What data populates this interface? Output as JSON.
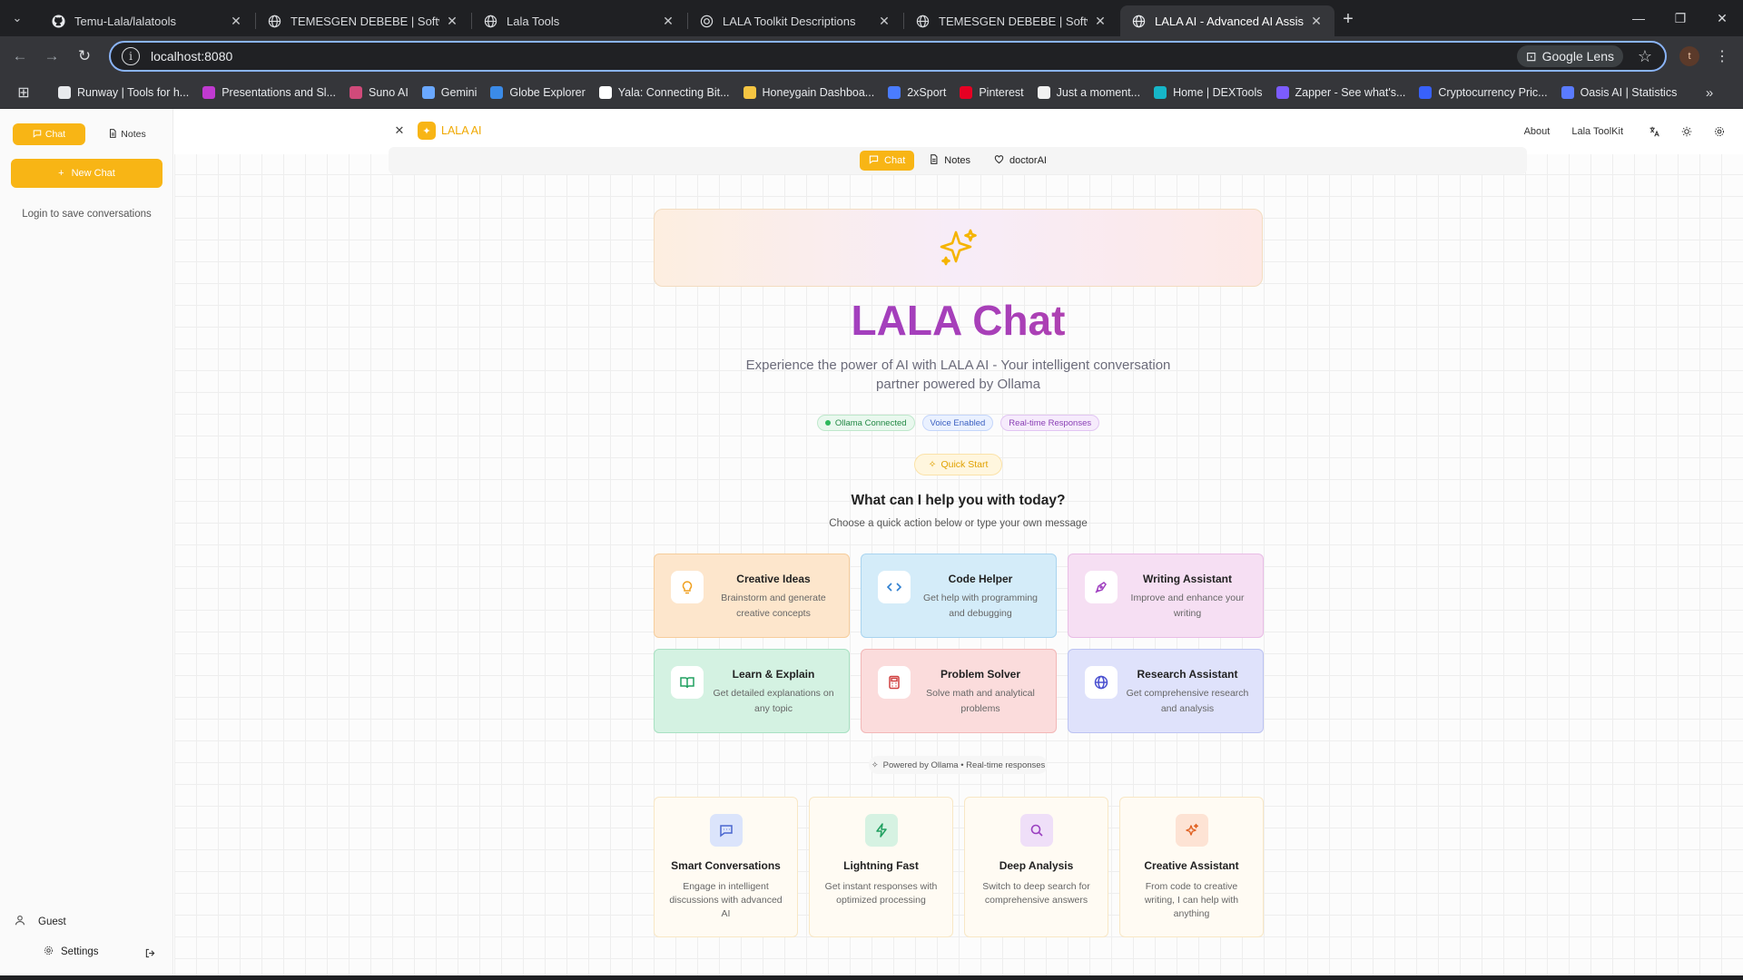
{
  "browser": {
    "tabs": [
      {
        "title": "Temu-Lala/lalatools",
        "icon": "github-icon"
      },
      {
        "title": "TEMESGEN DEBEBE | Software E",
        "icon": "globe-icon"
      },
      {
        "title": "Lala Tools",
        "icon": "globe-icon"
      },
      {
        "title": "LALA Toolkit Descriptions",
        "icon": "globe-icon"
      },
      {
        "title": "TEMESGEN DEBEBE | Software E",
        "icon": "globe-icon"
      },
      {
        "title": "LALA AI - Advanced AI Assistan",
        "icon": "globe-icon",
        "active": true
      }
    ],
    "url": "localhost:8080",
    "lens_label": "Google Lens",
    "profile_initial": "t",
    "bookmarks": [
      {
        "label": "Runway | Tools for h...",
        "color": "#e8eaed"
      },
      {
        "label": "Presentations and Sl...",
        "color": "#c03ad0"
      },
      {
        "label": "Suno AI",
        "color": "#d04a7a"
      },
      {
        "label": "Gemini",
        "color": "#6aa8ff"
      },
      {
        "label": "Globe Explorer",
        "color": "#3b8be8"
      },
      {
        "label": "Yala: Connecting Bit...",
        "color": "#ffffff"
      },
      {
        "label": "Honeygain Dashboa...",
        "color": "#f5c542"
      },
      {
        "label": "2xSport",
        "color": "#4a7cff"
      },
      {
        "label": "Pinterest",
        "color": "#e60023"
      },
      {
        "label": "Just a moment...",
        "color": "#f1f1f1"
      },
      {
        "label": "Home | DEXTools",
        "color": "#16b6c8"
      },
      {
        "label": "Zapper - See what's...",
        "color": "#7c5cff"
      },
      {
        "label": "Cryptocurrency Pric...",
        "color": "#3861fb"
      },
      {
        "label": "Oasis AI | Statistics",
        "color": "#5a7bff"
      }
    ]
  },
  "sidebar": {
    "tabs": [
      {
        "label": "Chat",
        "active": true
      },
      {
        "label": "Notes",
        "active": false
      }
    ],
    "new_chat_label": "New Chat",
    "login_note": "Login to save conversations",
    "user_label": "Guest",
    "settings_label": "Settings"
  },
  "header": {
    "brand": "LALA AI",
    "links": [
      "About",
      "Lala ToolKit"
    ],
    "modes": [
      {
        "label": "Chat",
        "active": true
      },
      {
        "label": "Notes",
        "active": false
      },
      {
        "label": "doctorAI",
        "active": false
      }
    ]
  },
  "hero": {
    "title": "LALA Chat",
    "subtitle": "Experience the power of AI with LALA AI - Your intelligent conversation partner powered by Ollama",
    "badges": [
      "Ollama Connected",
      "Voice Enabled",
      "Real-time Responses"
    ],
    "quick_start": "Quick Start",
    "help_title": "What can I help you with today?",
    "help_subtitle": "Choose a quick action below or type your own message"
  },
  "actions": [
    {
      "title": "Creative Ideas",
      "desc": "Brainstorm and generate creative concepts",
      "icon": "lightbulb-icon",
      "color": "#f0a020"
    },
    {
      "title": "Code Helper",
      "desc": "Get help with programming and debugging",
      "icon": "code-icon",
      "color": "#2f7fd0"
    },
    {
      "title": "Writing Assistant",
      "desc": "Improve and enhance your writing",
      "icon": "pen-icon",
      "color": "#a040c0"
    },
    {
      "title": "Learn & Explain",
      "desc": "Get detailed explanations on any topic",
      "icon": "book-icon",
      "color": "#20a060"
    },
    {
      "title": "Problem Solver",
      "desc": "Solve math and analytical problems",
      "icon": "calculator-icon",
      "color": "#d04040"
    },
    {
      "title": "Research Assistant",
      "desc": "Get comprehensive research and analysis",
      "icon": "globe-icon",
      "color": "#4a50d0"
    }
  ],
  "powered_by": "Powered by Ollama • Real-time responses",
  "features": [
    {
      "title": "Smart Conversations",
      "desc": "Engage in intelligent discussions with advanced AI",
      "icon": "message-icon",
      "bg": "#dbe4fb",
      "color": "#4a66d0"
    },
    {
      "title": "Lightning Fast",
      "desc": "Get instant responses with optimized processing",
      "icon": "lightning-icon",
      "bg": "#d6f2e2",
      "color": "#20a060"
    },
    {
      "title": "Deep Analysis",
      "desc": "Switch to deep search for comprehensive answers",
      "icon": "search-icon",
      "bg": "#efdff8",
      "color": "#9a40c0"
    },
    {
      "title": "Creative Assistant",
      "desc": "From code to creative writing, I can help with anything",
      "icon": "sparkle-icon",
      "bg": "#fde3d4",
      "color": "#e06020"
    }
  ]
}
